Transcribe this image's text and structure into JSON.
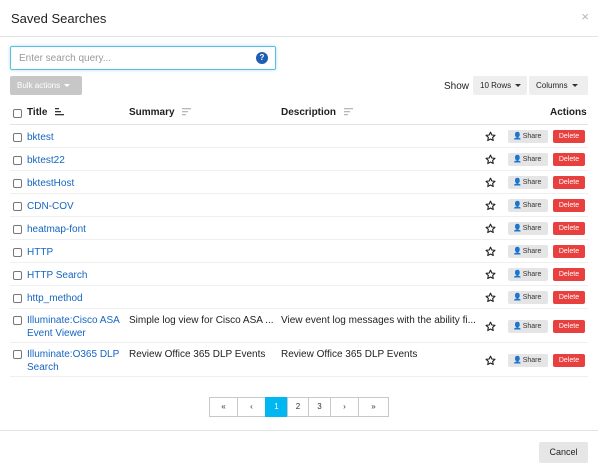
{
  "modal": {
    "title": "Saved Searches",
    "close_glyph": "×"
  },
  "search": {
    "placeholder": "Enter search query...",
    "help_glyph": "?"
  },
  "toolbar": {
    "bulk_label": "Bulk actions",
    "show_label": "Show",
    "rows_label": "10 Rows",
    "columns_label": "Columns"
  },
  "table": {
    "headers": {
      "title": "Title",
      "summary": "Summary",
      "description": "Description",
      "actions": "Actions"
    },
    "share_label": "Share",
    "delete_label": "Delete",
    "rows": [
      {
        "title_lines": [
          "bktest"
        ],
        "summary": "",
        "description": ""
      },
      {
        "title_lines": [
          "bktest22"
        ],
        "summary": "",
        "description": ""
      },
      {
        "title_lines": [
          "bktestHost"
        ],
        "summary": "",
        "description": ""
      },
      {
        "title_lines": [
          "CDN-COV"
        ],
        "summary": "",
        "description": ""
      },
      {
        "title_lines": [
          "heatmap-font"
        ],
        "summary": "",
        "description": ""
      },
      {
        "title_lines": [
          "HTTP"
        ],
        "summary": "",
        "description": ""
      },
      {
        "title_lines": [
          "HTTP Search"
        ],
        "summary": "",
        "description": ""
      },
      {
        "title_lines": [
          "http_method"
        ],
        "summary": "",
        "description": ""
      },
      {
        "title_lines": [
          "Illuminate:Cisco ASA",
          "Event Viewer"
        ],
        "summary": "Simple log view for Cisco ASA ...",
        "description": "View event log messages with the ability fi..."
      },
      {
        "title_lines": [
          "Illuminate:O365 DLP",
          "Search"
        ],
        "summary": "Review Office 365 DLP Events",
        "description": "Review Office 365 DLP Events"
      }
    ]
  },
  "pagination": {
    "first": "«",
    "prev": "‹",
    "pages": [
      "1",
      "2",
      "3"
    ],
    "active_page": "1",
    "next": "›",
    "last": "»"
  },
  "footer": {
    "cancel_label": "Cancel"
  },
  "colors": {
    "link": "#1565c0",
    "delete": "#e8403e",
    "active_page": "#00b7f1",
    "focus_border": "#5bc0de",
    "help_icon": "#1e5fb3"
  }
}
